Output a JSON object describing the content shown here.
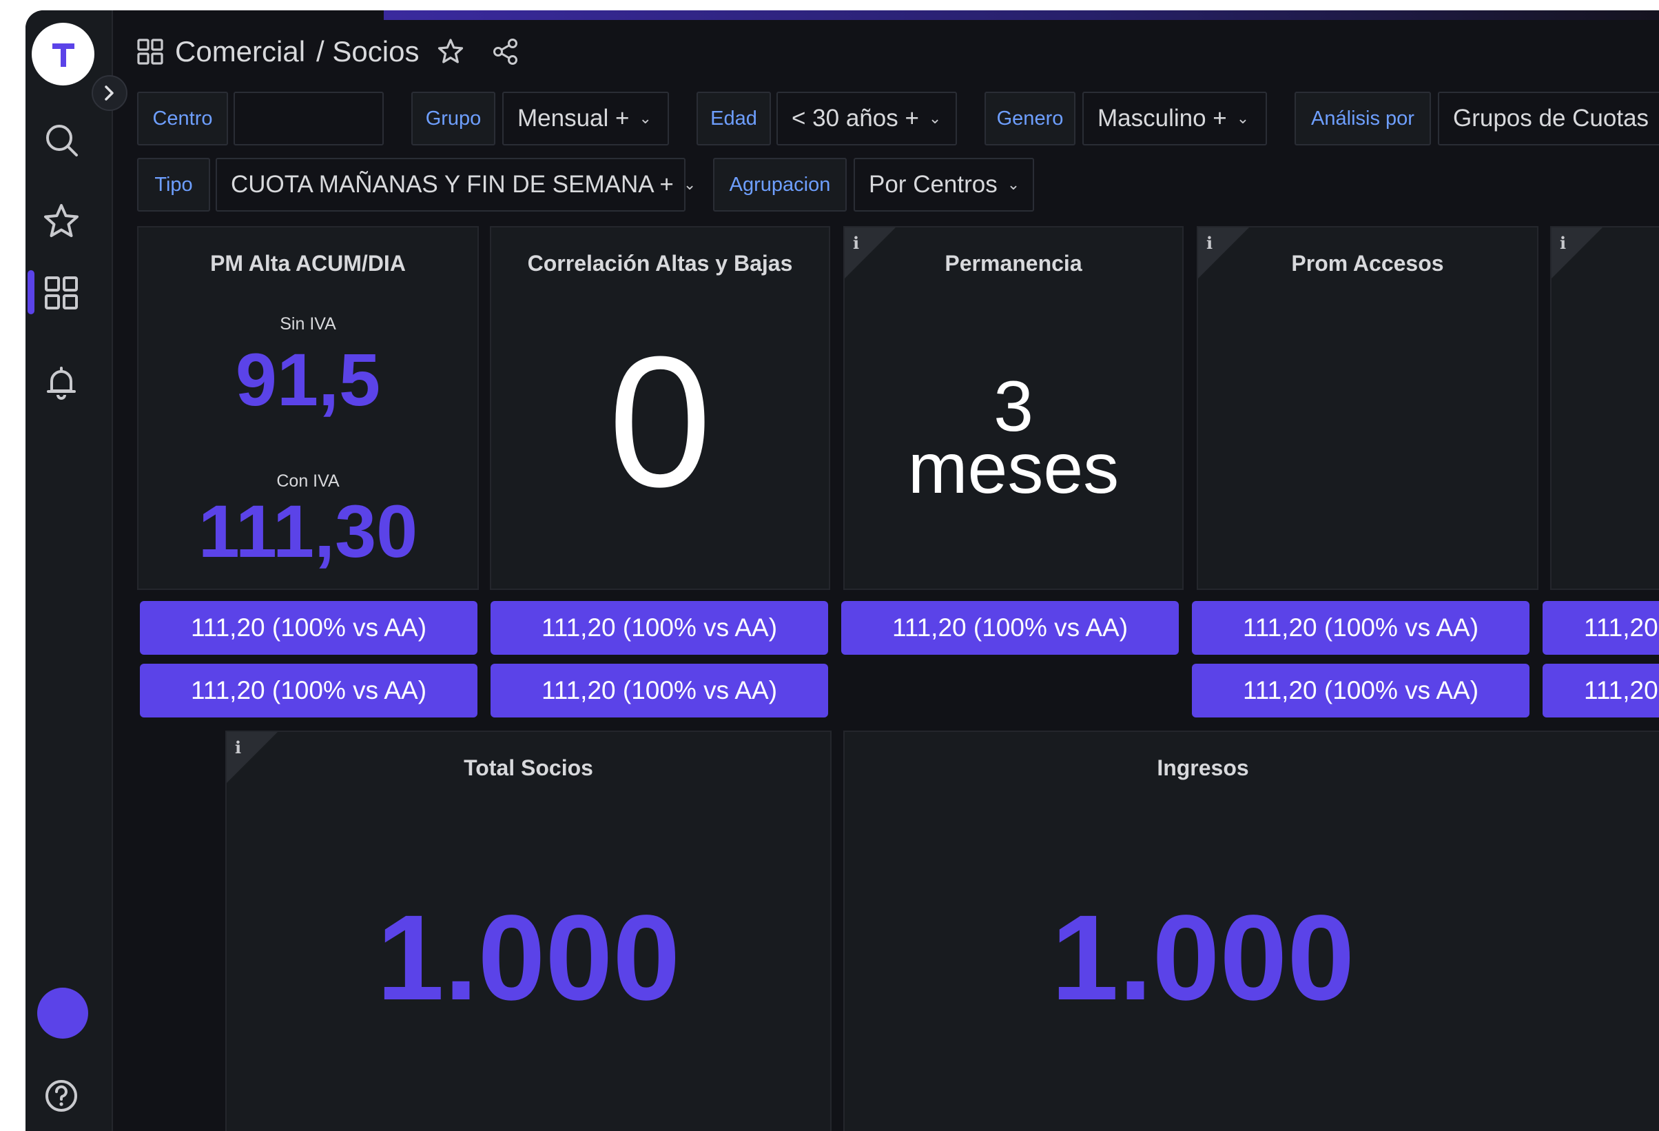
{
  "colors": {
    "accent": "#5b43e8",
    "filter_label": "#6e9fff",
    "background": "#111217",
    "panel": "#181b1f",
    "text": "#d8d9dc"
  },
  "sidebar": {
    "logo_letter": "T",
    "icons": [
      "search-icon",
      "star-icon",
      "dashboards-icon",
      "bell-icon",
      "help-icon"
    ],
    "active_item": "dashboards-icon"
  },
  "header": {
    "crumb_section": "Comercial",
    "crumb_page": "/ Socios"
  },
  "filters": {
    "centro": {
      "label": "Centro",
      "value": ""
    },
    "grupo": {
      "label": "Grupo",
      "value": "Mensual +"
    },
    "edad": {
      "label": "Edad",
      "value": "< 30 años +"
    },
    "genero": {
      "label": "Genero",
      "value": "Masculino +"
    },
    "analisis": {
      "label": "Análisis por",
      "value": "Grupos de Cuotas"
    },
    "tipo": {
      "label": "Tipo",
      "value": "CUOTA MAÑANAS Y FIN DE SEMANA +"
    },
    "agrupacion": {
      "label": "Agrupacion",
      "value": "Por Centros"
    }
  },
  "panels": {
    "pm_alta": {
      "title": "PM Alta ACUM/DIA",
      "sin_iva_label": "Sin IVA",
      "sin_iva_value": "91,5",
      "con_iva_label": "Con IVA",
      "con_iva_value": "111,30"
    },
    "correlacion": {
      "title": "Correlación Altas y Bajas",
      "value": "0"
    },
    "permanencia": {
      "title": "Permanencia",
      "value": "3",
      "unit": "meses"
    },
    "prom_accesos": {
      "title": "Prom Accesos"
    },
    "total_socios": {
      "title": "Total Socios",
      "value": "1.000"
    },
    "ingresos": {
      "title": "Ingresos",
      "value": "1.000"
    }
  },
  "pills": {
    "full": "111,20 (100% vs AA)",
    "clipped": "111,20"
  }
}
